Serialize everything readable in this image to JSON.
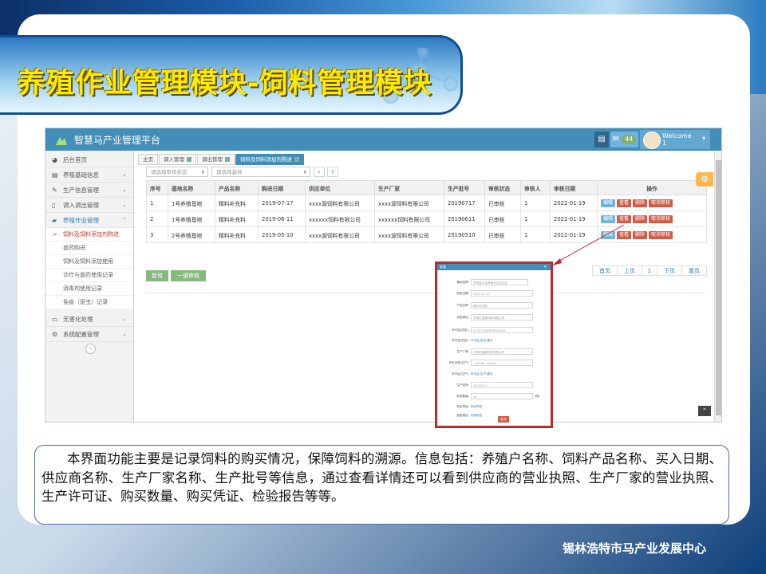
{
  "slide_title": "养殖作业管理模块-饲料管理模块",
  "app": {
    "title": "智慧马产业管理平台",
    "notification_count": "44",
    "welcome": "Welcome",
    "user_id": "1"
  },
  "sidebar": {
    "items": [
      {
        "label": "后台首页"
      },
      {
        "label": "养殖基础信息"
      },
      {
        "label": "生产信息管理"
      },
      {
        "label": "调入调出管理"
      },
      {
        "label": "养殖作业管理"
      }
    ],
    "sub_items": [
      {
        "label": "饲料及饲料添加剂购进"
      },
      {
        "label": "兽药购进"
      },
      {
        "label": "饲料及饲料添加使用"
      },
      {
        "label": "诊疗与兽药使用记录"
      },
      {
        "label": "消毒剂使用记录"
      },
      {
        "label": "免疫（驱虫）记录"
      }
    ],
    "items_bottom": [
      {
        "label": "无害化处理"
      },
      {
        "label": "系统配置管理"
      }
    ]
  },
  "tabs": [
    {
      "label": "主页"
    },
    {
      "label": "调入管理"
    },
    {
      "label": "调出管理"
    },
    {
      "label": "饲料及饲料添加剂购进"
    }
  ],
  "filters": {
    "status_placeholder": "请选择审核状态",
    "base_placeholder": "请选择基地"
  },
  "table": {
    "headers": [
      "序号",
      "基地名称",
      "产品名称",
      "购进日期",
      "供应单位",
      "生产厂家",
      "生产批号",
      "审核状态",
      "审核人",
      "审核日期",
      "操作"
    ],
    "rows": [
      [
        "1",
        "1号养殖基地",
        "精料补充料",
        "2019-07-17",
        "xxxx源饲料有限公司",
        "xxxx源饲料有限公司",
        "20190717",
        "已审核",
        "1",
        "2022-01-19"
      ],
      [
        "2",
        "1号养殖基地",
        "精料补充料",
        "2019-06-11",
        "xxxxxx饲料有限公司",
        "xxxxxx饲料有限公司",
        "20190611",
        "已审核",
        "1",
        "2022-01-19"
      ],
      [
        "3",
        "2号养殖基地",
        "精料补充料",
        "2019-05-10",
        "xxxx源饲料有限公司",
        "xxxx源饲料有限公司",
        "20190510",
        "已审核",
        "1",
        "2022-01-19"
      ]
    ],
    "actions": [
      "编辑",
      "查看",
      "删除",
      "取消审核"
    ]
  },
  "buttons": {
    "add": "新增",
    "batch_review": "一键审核"
  },
  "pager": {
    "first": "首页",
    "prev": "上页",
    "page": "1",
    "next": "下页",
    "last": "尾页"
  },
  "popup": {
    "title": "查看",
    "fields": [
      {
        "label": "基地名称:",
        "value": "东阿县众合养殖专业合作社"
      },
      {
        "label": "购进日期:",
        "value": "2019-07-17"
      },
      {
        "label": "产品名称:",
        "value": "精料补充料"
      },
      {
        "label": "供应单位:",
        "value": "东阿红福源饲料有限公司"
      },
      {
        "label": "许可证(供应):",
        "value": "91371524MA3P5D0X4"
      },
      {
        "label": "许可证(供应):",
        "value": "许可证(供应)图片"
      },
      {
        "label": "生产厂家:",
        "value": "东阿红福源饲料有限公司"
      },
      {
        "label": "许可证号(生产):",
        "value": "（2018）10008"
      },
      {
        "label": "许可证(生产):",
        "value": "许可证(生产)图片"
      },
      {
        "label": "生产批号:",
        "value": "20190717"
      },
      {
        "label": "购进数量:",
        "value": "10",
        "unit": "(吨)"
      },
      {
        "label": "购买凭证:",
        "value": "购买凭证"
      },
      {
        "label": "检验报告:",
        "value": "检验报告"
      }
    ],
    "close_button": "取消"
  },
  "description": "本界面功能主要是记录饲料的购买情况，保障饲料的溯源。信息包括：养殖户名称、饲料产品名称、买入日期、供应商名称、生产厂家名称、生产批号等信息，通过查看详情还可以看到供应商的营业执照、生产厂家的营业执照、生产许可证、购买数量、购买凭证、检验报告等等。",
  "footer_org": "锡林浩特市马产业发展中心",
  "colors": {
    "header_blue": "#438eb9",
    "title_yellow": "#ffea00",
    "danger_red": "#d15b47",
    "success_green": "#87b87f",
    "popup_border": "#c0282d"
  }
}
